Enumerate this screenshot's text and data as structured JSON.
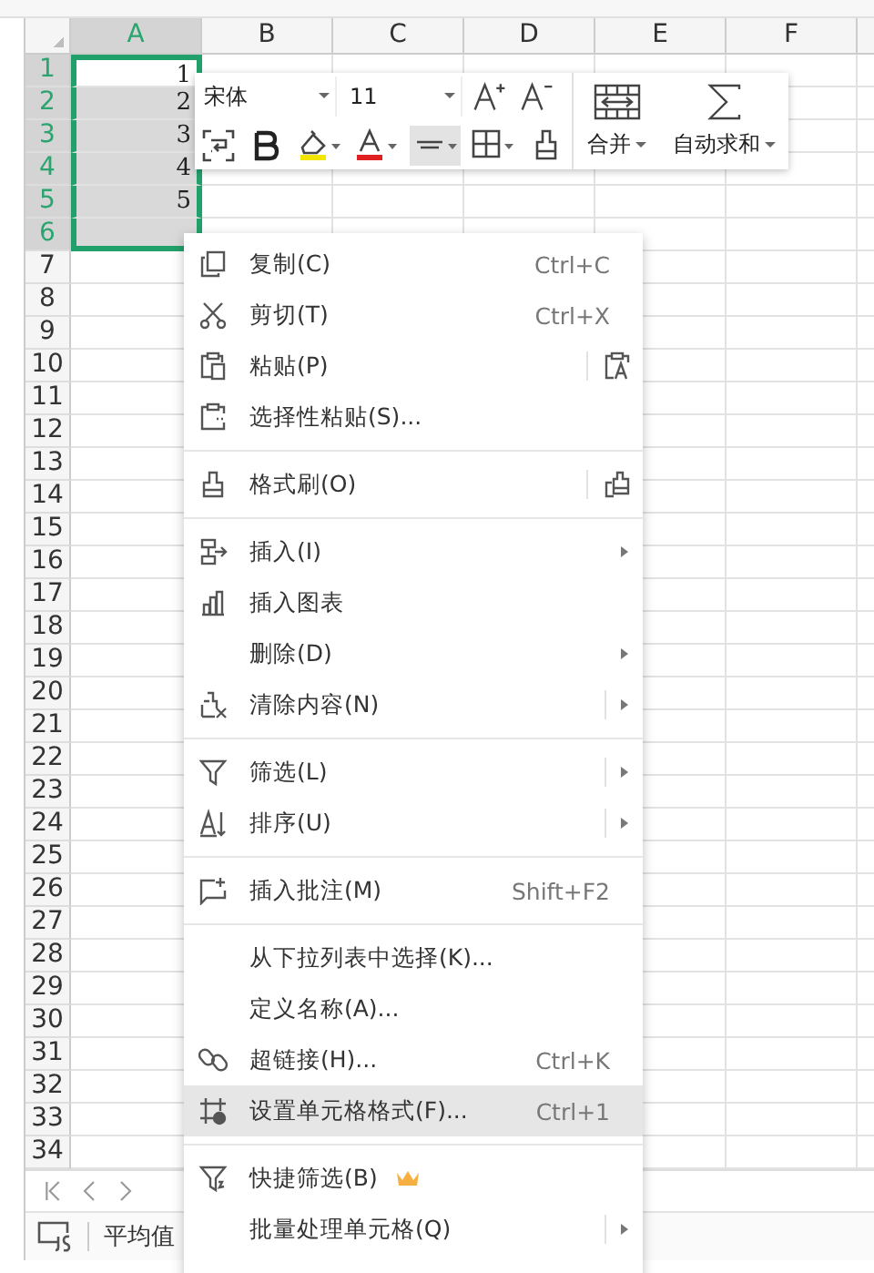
{
  "columns": [
    {
      "label": "A",
      "selected": true
    },
    {
      "label": "B",
      "selected": false
    },
    {
      "label": "C",
      "selected": false
    },
    {
      "label": "D",
      "selected": false
    },
    {
      "label": "E",
      "selected": false
    },
    {
      "label": "F",
      "selected": false
    }
  ],
  "rows": [
    {
      "label": "1",
      "selected": true,
      "value": "1"
    },
    {
      "label": "2",
      "selected": true,
      "value": "2"
    },
    {
      "label": "3",
      "selected": true,
      "value": "3"
    },
    {
      "label": "4",
      "selected": true,
      "value": "4"
    },
    {
      "label": "5",
      "selected": true,
      "value": "5"
    },
    {
      "label": "6",
      "selected": true
    },
    {
      "label": "7",
      "selected": false
    },
    {
      "label": "8",
      "selected": false
    },
    {
      "label": "9",
      "selected": false
    },
    {
      "label": "10",
      "selected": false
    },
    {
      "label": "11",
      "selected": false
    },
    {
      "label": "12",
      "selected": false
    },
    {
      "label": "13",
      "selected": false
    },
    {
      "label": "14",
      "selected": false
    },
    {
      "label": "15",
      "selected": false
    },
    {
      "label": "16",
      "selected": false
    },
    {
      "label": "17",
      "selected": false
    },
    {
      "label": "18",
      "selected": false
    },
    {
      "label": "19",
      "selected": false
    },
    {
      "label": "20",
      "selected": false
    },
    {
      "label": "21",
      "selected": false
    },
    {
      "label": "22",
      "selected": false
    },
    {
      "label": "23",
      "selected": false
    },
    {
      "label": "24",
      "selected": false
    },
    {
      "label": "25",
      "selected": false
    },
    {
      "label": "26",
      "selected": false
    },
    {
      "label": "27",
      "selected": false
    },
    {
      "label": "28",
      "selected": false
    },
    {
      "label": "29",
      "selected": false
    },
    {
      "label": "30",
      "selected": false
    },
    {
      "label": "31",
      "selected": false
    },
    {
      "label": "32",
      "selected": false
    },
    {
      "label": "33",
      "selected": false
    },
    {
      "label": "34",
      "selected": false
    }
  ],
  "mini_toolbar": {
    "font": "宋体",
    "size": "11",
    "align_selected": true,
    "merge": "合并",
    "autosum": "自动求和"
  },
  "context_menu": {
    "items": [
      {
        "kind": "item",
        "label": "复制(C)",
        "shortcut": "Ctrl+C",
        "submenu": false,
        "selected": false
      },
      {
        "kind": "item",
        "label": "剪切(T)",
        "shortcut": "Ctrl+X",
        "submenu": false,
        "selected": false
      },
      {
        "kind": "item",
        "label": "粘贴(P)",
        "submenu": false,
        "selected": false
      },
      {
        "kind": "item",
        "label": "选择性粘贴(S)...",
        "submenu": false,
        "selected": false
      },
      {
        "kind": "separator"
      },
      {
        "kind": "item",
        "label": "格式刷(O)",
        "submenu": false,
        "selected": false
      },
      {
        "kind": "separator"
      },
      {
        "kind": "item",
        "label": "插入(I)",
        "submenu": true,
        "split": false,
        "selected": false
      },
      {
        "kind": "item",
        "label": "插入图表",
        "submenu": false,
        "selected": false
      },
      {
        "kind": "item",
        "label": "删除(D)",
        "submenu": true,
        "split": false,
        "selected": false
      },
      {
        "kind": "item",
        "label": "清除内容(N)",
        "submenu": true,
        "split": true,
        "selected": false
      },
      {
        "kind": "separator"
      },
      {
        "kind": "item",
        "label": "筛选(L)",
        "submenu": true,
        "split": true,
        "selected": false
      },
      {
        "kind": "item",
        "label": "排序(U)",
        "submenu": true,
        "split": true,
        "selected": false
      },
      {
        "kind": "separator"
      },
      {
        "kind": "item",
        "label": "插入批注(M)",
        "shortcut": "Shift+F2",
        "submenu": false,
        "selected": false
      },
      {
        "kind": "separator"
      },
      {
        "kind": "item",
        "label": "从下拉列表中选择(K)...",
        "submenu": false,
        "selected": false
      },
      {
        "kind": "item",
        "label": "定义名称(A)...",
        "submenu": false,
        "selected": false
      },
      {
        "kind": "item",
        "label": "超链接(H)...",
        "shortcut": "Ctrl+K",
        "submenu": false,
        "selected": false
      },
      {
        "kind": "item",
        "label": "设置单元格格式(F)...",
        "shortcut": "Ctrl+1",
        "submenu": false,
        "selected": true
      },
      {
        "kind": "separator"
      },
      {
        "kind": "item",
        "label": "快捷筛选(B)",
        "premium": true,
        "submenu": false,
        "selected": false
      },
      {
        "kind": "item",
        "label": "批量处理单元格(Q)",
        "submenu": true,
        "split": true,
        "selected": false
      }
    ]
  },
  "status_bar": {
    "summary": "平均值"
  }
}
